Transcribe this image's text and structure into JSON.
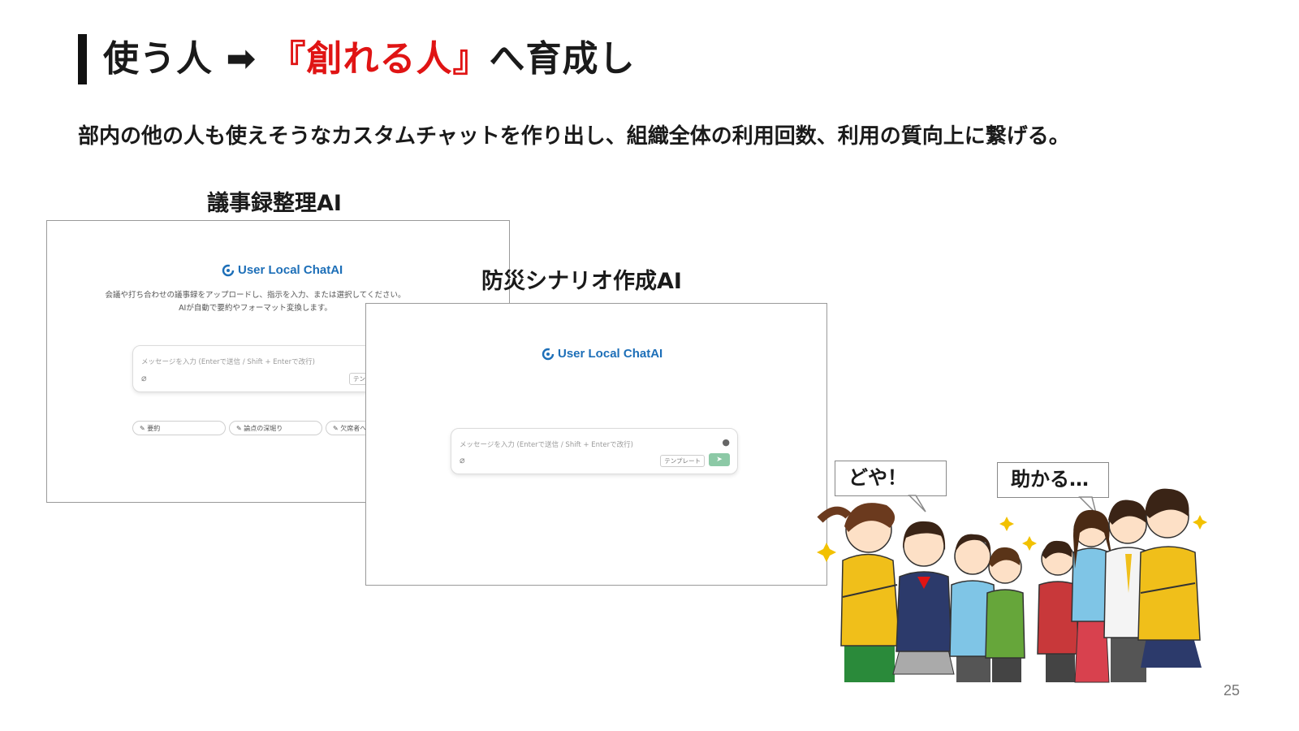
{
  "slide": {
    "title_prefix": "使う人 ➡ ",
    "title_highlight": "『創れる人』",
    "title_suffix": "へ育成し",
    "subtitle": "部内の他の人も使えそうなカスタムチャットを作り出し、組織全体の利用回数、利用の質向上に繋げる。",
    "page_number": "25"
  },
  "screenshot_1": {
    "label": "議事録整理AI",
    "logo_text": "User Local ChatAI",
    "description": "会議や打ち合わせの議事録をアップロードし、指示を入力、または選択してください。\nAIが自動で要約やフォーマット変換します。",
    "input_placeholder": "メッセージを入力 (Enterで送信 / Shift + Enterで改行)",
    "template_button": "テンプ",
    "chips": [
      "要約",
      "論点の深堀り",
      "欠席者へメ"
    ]
  },
  "screenshot_2": {
    "label": "防災シナリオ作成AI",
    "logo_text": "User Local ChatAI",
    "input_placeholder": "メッセージを入力 (Enterで送信 / Shift + Enterで改行)",
    "template_button": "テンプレート"
  },
  "illustration": {
    "bubble_left": "どや！",
    "bubble_right": "助かる…"
  },
  "colors": {
    "accent_red": "#e01414",
    "logo_blue": "#1d6fb8",
    "send_green": "#8cc9a6"
  },
  "icons": {
    "logo": "chatai-logo-icon",
    "attach": "paperclip-icon",
    "mic": "microphone-icon",
    "send": "send-icon",
    "chip": "pencil-icon"
  }
}
